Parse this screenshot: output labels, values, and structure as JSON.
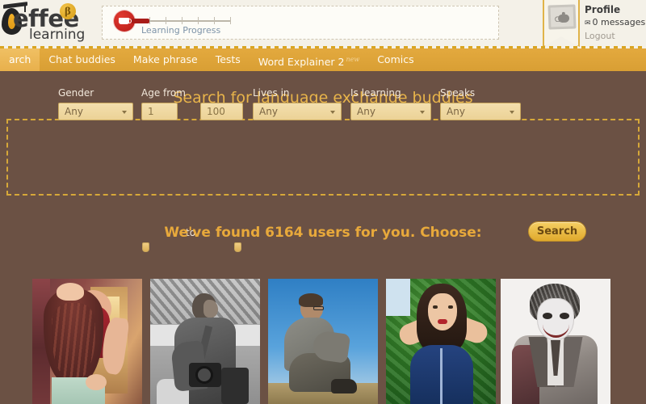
{
  "header": {
    "logo": {
      "word": "effee",
      "subtitle": "learning",
      "beta_badge": "β",
      "cap_icon": "graduation-cap-icon"
    },
    "progress": {
      "label": "Learning Progress",
      "badge_icon": "coffee-cup-icon",
      "fill_percent": 18,
      "tick_count": 6
    },
    "profile": {
      "avatar_icon": "teapot-photo-frame-icon",
      "profile_label": "Profile",
      "mail_icon": "✉",
      "messages_label": "0 messages",
      "logout_label": "Logout"
    }
  },
  "nav": {
    "items": [
      {
        "label": "arch",
        "active": true,
        "badge": ""
      },
      {
        "label": "Chat buddies",
        "active": false,
        "badge": ""
      },
      {
        "label": "Make phrase",
        "active": false,
        "badge": ""
      },
      {
        "label": "Tests",
        "active": false,
        "badge": ""
      },
      {
        "label": "Word Explainer 2",
        "active": false,
        "badge": "new"
      },
      {
        "label": "Comics",
        "active": false,
        "badge": ""
      }
    ]
  },
  "main": {
    "page_title": "Search for language exchange buddies",
    "results_headline": "We've found 6164 users for you. Choose:",
    "search_form": {
      "gender": {
        "label": "Gender",
        "value": "Any"
      },
      "age": {
        "label": "Age from",
        "from_value": "1",
        "to_word": "to",
        "to_value": "100"
      },
      "lives_in": {
        "label": "Lives in",
        "value": "Any"
      },
      "is_learning": {
        "label": "Is learning",
        "value": "Any"
      },
      "speaks": {
        "label": "Speaks",
        "value": "Any"
      },
      "search_button": "Search"
    },
    "thumbnails": [
      {
        "name": "user-photo-1",
        "alt": "woman with long auburn hair in red top"
      },
      {
        "name": "user-photo-2",
        "alt": "black and white photo of man holding camera"
      },
      {
        "name": "user-photo-3",
        "alt": "man sitting outdoors against blue sky"
      },
      {
        "name": "user-photo-4",
        "alt": "woman in navy top with hands behind head, green foliage"
      },
      {
        "name": "user-photo-5",
        "alt": "pencil sketch portrait of the joker"
      }
    ]
  },
  "colors": {
    "page_bg": "#6b5144",
    "nav_bg": "#d99f34",
    "nav_active": "#e8b04c",
    "accent_gold": "#e8b44a",
    "headline_gold": "#e8a93b",
    "header_bg": "#f4f1e8",
    "field_bg": "#ecd296",
    "progress_red": "#b81b18"
  }
}
